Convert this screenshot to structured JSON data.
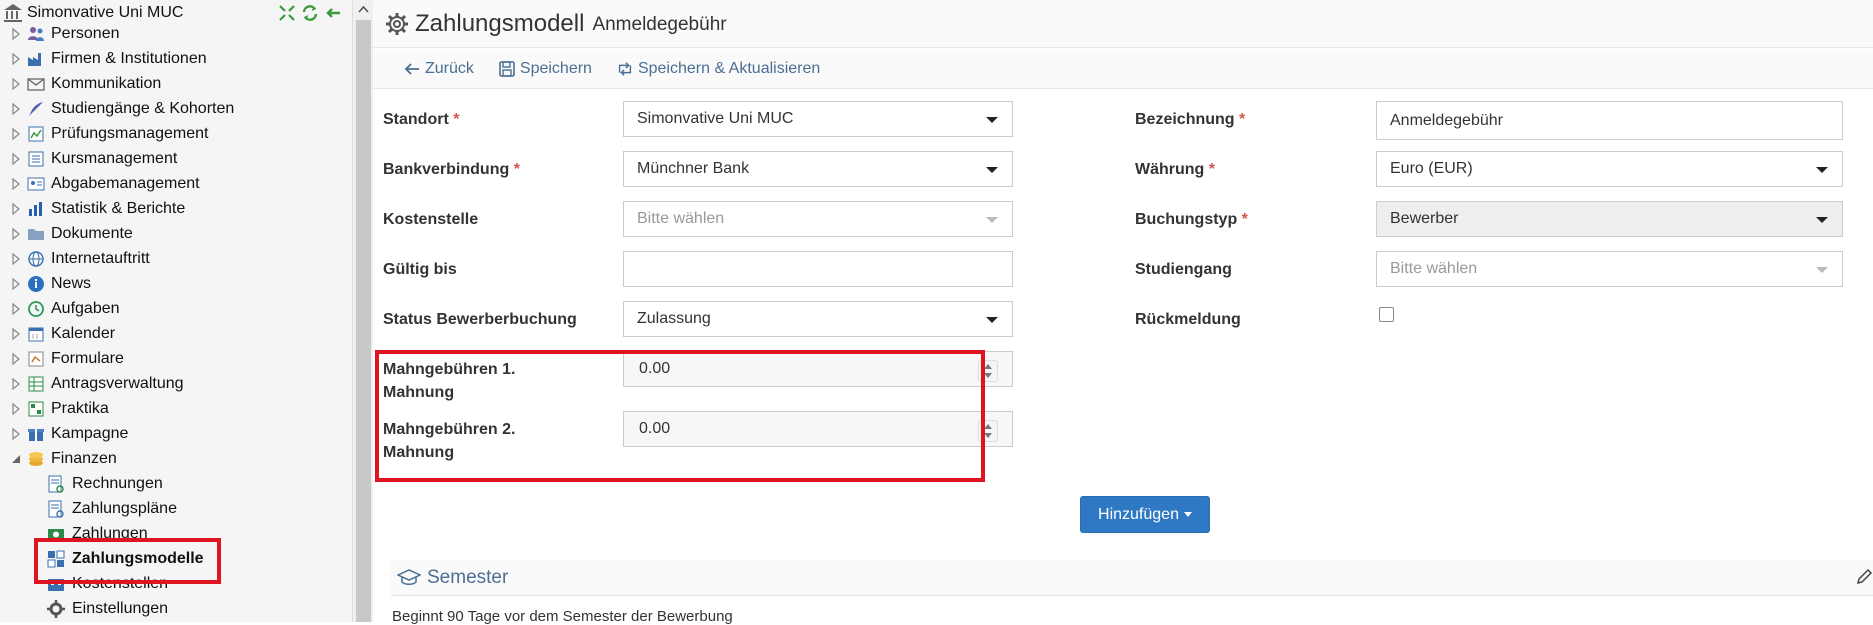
{
  "sidebar": {
    "root_label": "Simonvative Uni MUC",
    "items": [
      {
        "label": "Personen",
        "icon": "people-icon"
      },
      {
        "label": "Firmen & Institutionen",
        "icon": "factory-icon"
      },
      {
        "label": "Kommunikation",
        "icon": "envelope-icon"
      },
      {
        "label": "Studiengänge & Kohorten",
        "icon": "quill-icon"
      },
      {
        "label": "Prüfungsmanagement",
        "icon": "exam-chart-icon"
      },
      {
        "label": "Kursmanagement",
        "icon": "course-list-icon"
      },
      {
        "label": "Abgabemanagement",
        "icon": "submission-card-icon"
      },
      {
        "label": "Statistik & Berichte",
        "icon": "bar-chart-icon"
      },
      {
        "label": "Dokumente",
        "icon": "folder-icon"
      },
      {
        "label": "Internetauftritt",
        "icon": "globe-icon"
      },
      {
        "label": "News",
        "icon": "info-icon"
      },
      {
        "label": "Aufgaben",
        "icon": "clock-icon"
      },
      {
        "label": "Kalender",
        "icon": "calendar-icon"
      },
      {
        "label": "Formulare",
        "icon": "form-icon"
      },
      {
        "label": "Antragsverwaltung",
        "icon": "table-icon"
      },
      {
        "label": "Praktika",
        "icon": "grid-icon"
      },
      {
        "label": "Kampagne",
        "icon": "gift-icon"
      },
      {
        "label": "Finanzen",
        "icon": "coins-icon"
      }
    ],
    "finanzen_children": [
      {
        "label": "Rechnungen",
        "icon": "invoice-icon"
      },
      {
        "label": "Zahlungspläne",
        "icon": "payment-plan-icon"
      },
      {
        "label": "Zahlungen",
        "icon": "payment-icon"
      },
      {
        "label": "Zahlungsmodelle",
        "icon": "payment-model-icon"
      },
      {
        "label": "Kostenstellen",
        "icon": "cost-center-icon"
      },
      {
        "label": "Einstellungen",
        "icon": "gear-icon"
      }
    ]
  },
  "header": {
    "title": "Zahlungsmodell",
    "subtitle": "Anmeldegebühr"
  },
  "toolbar": {
    "back_label": "Zurück",
    "save_label": "Speichern",
    "save_refresh_label": "Speichern & Aktualisieren"
  },
  "form": {
    "standort": {
      "label": "Standort",
      "required": "*",
      "value": "Simonvative Uni MUC"
    },
    "bankverbindung": {
      "label": "Bankverbindung",
      "required": "*",
      "value": "Münchner Bank"
    },
    "kostenstelle": {
      "label": "Kostenstelle",
      "placeholder": "Bitte wählen"
    },
    "gueltig_bis": {
      "label": "Gültig bis",
      "value": ""
    },
    "status_bewerberbuchung": {
      "label": "Status Bewerberbuchung",
      "value": "Zulassung"
    },
    "mahngebuehren_1": {
      "label_line1": "Mahngebühren 1.",
      "label_line2": "Mahnung",
      "value": "0.00"
    },
    "mahngebuehren_2": {
      "label_line1": "Mahngebühren 2.",
      "label_line2": "Mahnung",
      "value": "0.00"
    },
    "bezeichnung": {
      "label": "Bezeichnung",
      "required": "*",
      "value": "Anmeldegebühr"
    },
    "waehrung": {
      "label": "Währung",
      "required": "*",
      "value": "Euro (EUR)"
    },
    "buchungstyp": {
      "label": "Buchungstyp",
      "required": "*",
      "value": "Bewerber"
    },
    "studiengang": {
      "label": "Studiengang",
      "placeholder": "Bitte wählen"
    },
    "rueckmeldung": {
      "label": "Rückmeldung",
      "checked": false
    }
  },
  "add_button_label": "Hinzufügen",
  "semester": {
    "title": "Semester",
    "description": "Beginnt 90 Tage vor dem Semester der Bewerbung"
  }
}
